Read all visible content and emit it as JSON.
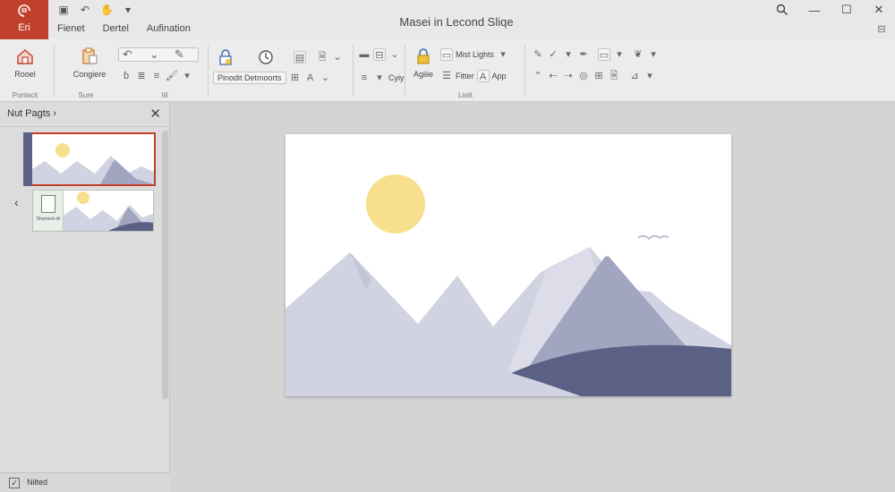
{
  "window": {
    "title": "Masei in Lecond Sliqe"
  },
  "file_tab": {
    "label": "Eri"
  },
  "menu": {
    "tabs": [
      "Fienet",
      "Dertel",
      "Aufination"
    ]
  },
  "ribbon": {
    "groups": {
      "first": {
        "button_label": "Rooel",
        "group_label": "Ponlacit"
      },
      "second": {
        "button_label": "Congiere",
        "group_label": "Sure"
      },
      "third": {
        "group_label": "Iiil"
      },
      "fourth": {
        "button_label": "Pinodit Detmoorts",
        "copy_label": "Cyiy"
      },
      "fifth": {
        "apply_label": "Agiiie",
        "lights_label": "Mist Lights",
        "filter_label": "Fitter",
        "app_label": "App",
        "group_label": "Lisiit"
      }
    }
  },
  "thumbnail_pane": {
    "title": "Nut Pagts",
    "badge_label": "Shemesh AI"
  },
  "status_bar": {
    "label": "Nilted"
  },
  "colors": {
    "accent": "#c0402b",
    "sun": "#f8df8e",
    "mountain_light": "#d2d3e2",
    "mountain_mid": "#a1a5bf",
    "mountain_dark": "#5a6185"
  }
}
